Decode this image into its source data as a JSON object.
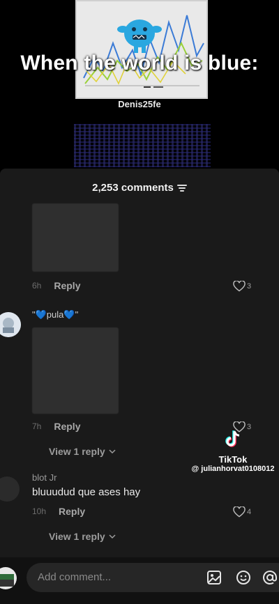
{
  "video": {
    "caption": "When the world is blue:",
    "creator": "Denis25fe"
  },
  "comments_header": {
    "count_label": "2,253 comments"
  },
  "comments": [
    {
      "time": "6h",
      "reply_label": "Reply",
      "likes": "3"
    },
    {
      "text": "\"💙pula💙\"",
      "time": "7h",
      "reply_label": "Reply",
      "likes": "3",
      "view_replies": "View 1 reply"
    },
    {
      "username": "blot Jr",
      "text": "bluuudud que ases hay",
      "time": "10h",
      "reply_label": "Reply",
      "likes": "4",
      "view_replies": "View 1 reply"
    }
  ],
  "watermark": {
    "brand": "TikTok",
    "handle": "@ julianhorvat0108012"
  },
  "composer": {
    "placeholder": "Add comment..."
  },
  "icons": [
    "sort-icon",
    "heart-icon",
    "chevron-down-icon",
    "image-icon",
    "emoji-icon",
    "mention-icon",
    "tiktok-logo-icon"
  ],
  "colors": {
    "sheet": "#1a1a1a",
    "background": "#000000",
    "input": "#262626",
    "mascot": "#2aa7e0"
  }
}
